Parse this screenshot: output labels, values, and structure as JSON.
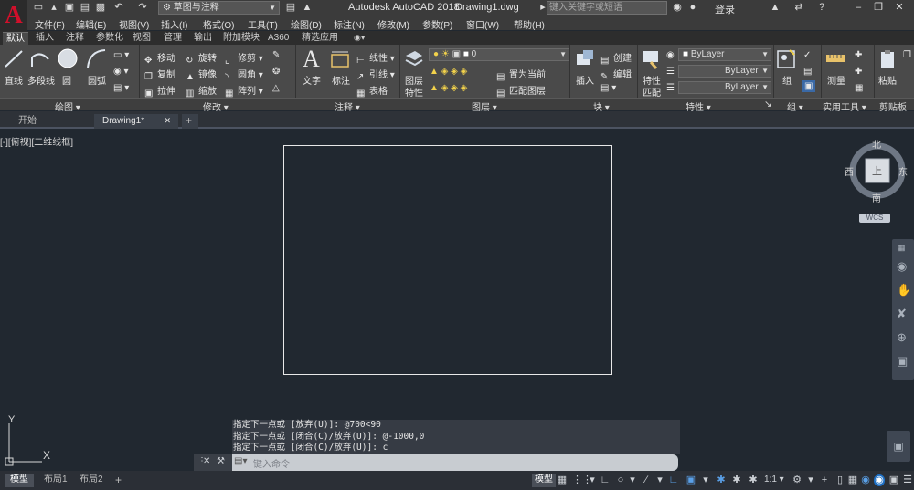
{
  "app_logo": "A",
  "titlebar": {
    "workspace": "草图与注释",
    "app_name": "Autodesk AutoCAD 2018",
    "doc_name": "Drawing1.dwg",
    "search_placeholder": "键入关键字或短语",
    "login": "登录"
  },
  "menubar": [
    "文件(F)",
    "编辑(E)",
    "视图(V)",
    "插入(I)",
    "格式(O)",
    "工具(T)",
    "绘图(D)",
    "标注(N)",
    "修改(M)",
    "参数(P)",
    "窗口(W)",
    "帮助(H)"
  ],
  "ribbon_tabs": [
    "默认",
    "插入",
    "注释",
    "参数化",
    "视图",
    "管理",
    "输出",
    "附加模块",
    "A360",
    "精选应用"
  ],
  "ribbon": {
    "draw": {
      "line": "直线",
      "polyline": "多段线",
      "circle": "圆",
      "arc": "圆弧"
    },
    "modify": {
      "move": "移动",
      "rotate": "旋转",
      "trim": "修剪",
      "copy": "复制",
      "mirror": "镜像",
      "fillet": "圆角",
      "stretch": "拉伸",
      "scale": "缩放",
      "array": "阵列"
    },
    "annotation": {
      "text": "文字",
      "dimension": "标注",
      "linear": "线性",
      "leader": "引线",
      "table": "表格"
    },
    "layers": {
      "properties_line1": "图层",
      "properties_line2": "特性",
      "current_layer": "0",
      "set_current": "置为当前",
      "match_layer": "匹配图层"
    },
    "block": {
      "insert": "插入",
      "create": "创建",
      "edit": "编辑"
    },
    "properties": {
      "match_line1": "特性",
      "match_line2": "匹配",
      "color": "ByLayer",
      "linetype": "ByLayer",
      "lineweight": "ByLayer"
    },
    "groups": {
      "group": "组"
    },
    "utilities": {
      "measure": "测量"
    },
    "clipboard": {
      "paste": "粘贴"
    }
  },
  "panel_titles": [
    "绘图",
    "修改",
    "注释",
    "图层",
    "块",
    "特性",
    "组",
    "实用工具",
    "剪贴板"
  ],
  "doc_tabs": [
    "开始",
    "Drawing1*"
  ],
  "viewport_label": "[-][俯视][二维线框]",
  "viewcube": {
    "north": "北",
    "south": "南",
    "west": "西",
    "east": "东",
    "top": "上",
    "wcs": "WCS"
  },
  "ucs": {
    "x": "X",
    "y": "Y"
  },
  "command_history": [
    "指定下一点或 [放弃(U)]: @700<90",
    "指定下一点或 [闭合(C)/放弃(U)]: @-1000,0",
    "指定下一点或 [闭合(C)/放弃(U)]: c"
  ],
  "command_placeholder": "键入命令",
  "layout_tabs": [
    "模型",
    "布局1",
    "布局2"
  ],
  "status": {
    "model": "模型",
    "scale": "1:1"
  },
  "colors": {
    "canvas": "#212830",
    "ribbon": "#4a4a4a",
    "accent": "#1e6fc4"
  }
}
